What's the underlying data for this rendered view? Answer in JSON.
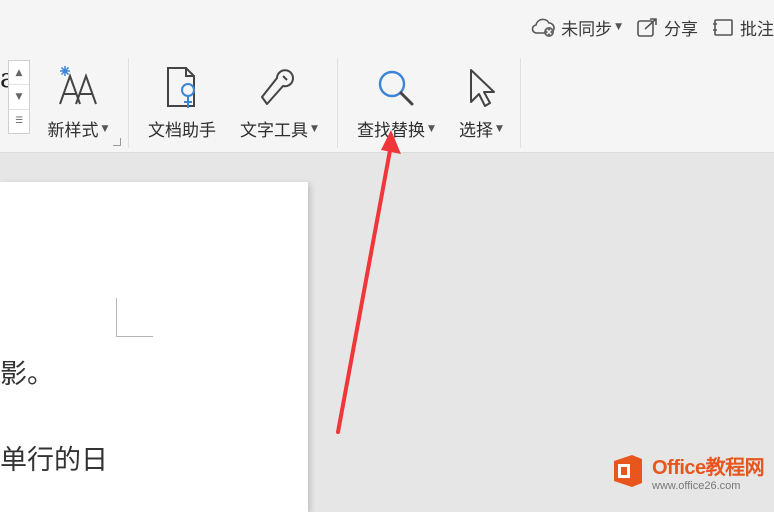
{
  "topbar": {
    "sync_label": "未同步",
    "share_label": "分享",
    "review_label": "批注"
  },
  "ribbon": {
    "new_style_label": "新样式",
    "doc_assistant_label": "文档助手",
    "text_tools_label": "文字工具",
    "find_replace_label": "查找替换",
    "select_label": "选择",
    "partial_style_glyph": "a"
  },
  "document": {
    "line1": "影。",
    "line2": "单行的日"
  },
  "watermark": {
    "title": "Office教程网",
    "url": "www.office26.com"
  },
  "colors": {
    "arrow": "#f0363a",
    "accent_orange": "#e8561e",
    "search_blue": "#3c85d6"
  }
}
